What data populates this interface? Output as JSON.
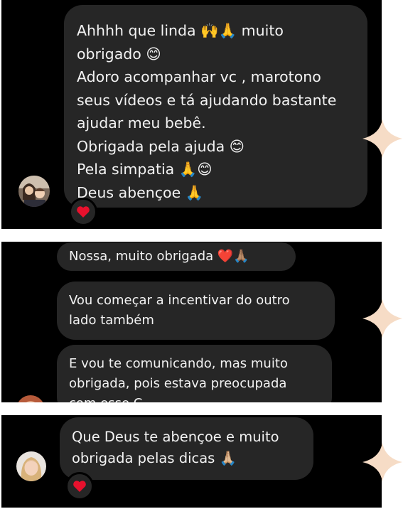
{
  "colors": {
    "page_background": "#ffffff",
    "chat_background": "#000000",
    "bubble_background": "#262626",
    "text": "#f2f2f2",
    "heart": "#e8112d",
    "sparkle": "#f6dcc6"
  },
  "panel1": {
    "message": "Ahhhh que linda 🙌🙏 muito\nobrigado 😊\nAdoro acompanhar vc , marotono\nseus vídeos e tá ajudando bastante\najudar meu bebê.\nObrigada pela ajuda 😊\nPela simpatia 🙏😊\nDeus abençoe 🙏",
    "reaction": "❤️"
  },
  "panel2": {
    "messages": [
      "Nossa, muito obrigada ❤️🙏🏽",
      "Vou começar a incentivar do outro\nlado também",
      "E vou te comunicando, mas muito\nobrigada, pois estava preocupada\ncom esse C"
    ]
  },
  "panel3": {
    "message": "Que Deus te abençoe e muito\nobrigada pelas dicas 🙏🏼",
    "reaction": "❤️"
  }
}
